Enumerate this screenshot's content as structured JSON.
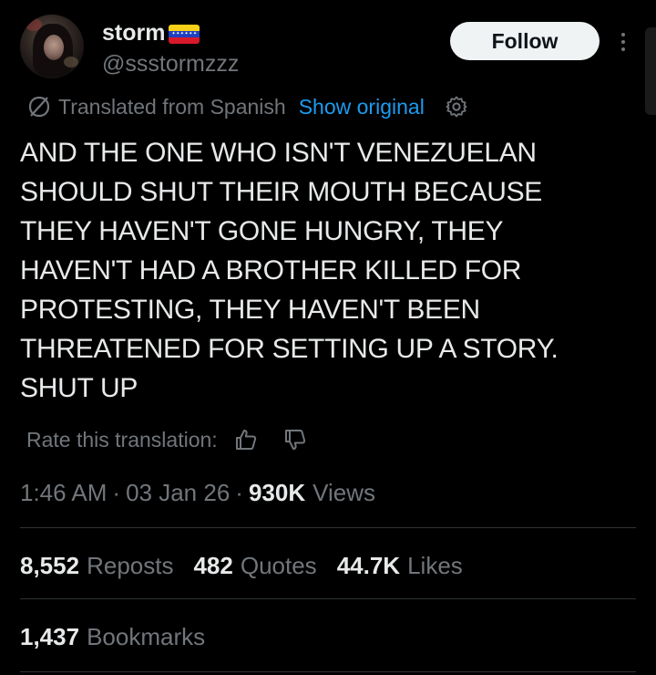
{
  "author": {
    "display_name": "storm",
    "handle": "@ssstormzzz"
  },
  "follow_label": "Follow",
  "translation": {
    "notice": "Translated from Spanish",
    "show_original": "Show original"
  },
  "tweet_lines": [
    "AND THE ONE WHO ISN'T VENEZUELAN",
    "SHOULD SHUT THEIR MOUTH BECAUSE",
    "THEY HAVEN'T GONE HUNGRY, THEY",
    "HAVEN'T HAD A BROTHER KILLED FOR",
    "PROTESTING, THEY HAVEN'T BEEN",
    "THREATENED FOR SETTING UP A STORY.",
    "SHUT UP"
  ],
  "rate_translation": "Rate this translation:",
  "meta": {
    "time": "1:46 AM",
    "separator": "·",
    "date": "03 Jan 26",
    "views_count": "930K",
    "views_label": "Views"
  },
  "stats": {
    "reposts_count": "8,552",
    "reposts_label": "Reposts",
    "quotes_count": "482",
    "quotes_label": "Quotes",
    "likes_count": "44.7K",
    "likes_label": "Likes",
    "bookmarks_count": "1,437",
    "bookmarks_label": "Bookmarks"
  },
  "icons": {
    "flag": "venezuela-flag-emoji",
    "translate": "translate-slash-icon",
    "settings": "gear-icon",
    "thumbs_up": "thumbs-up-icon",
    "thumbs_down": "thumbs-down-icon",
    "more": "more-vertical-icon"
  },
  "colors": {
    "background": "#000000",
    "text_primary": "#e7e9ea",
    "text_secondary": "#71767b",
    "link": "#1d9bf0",
    "follow_bg": "#eff3f4",
    "divider": "#2f3336"
  }
}
